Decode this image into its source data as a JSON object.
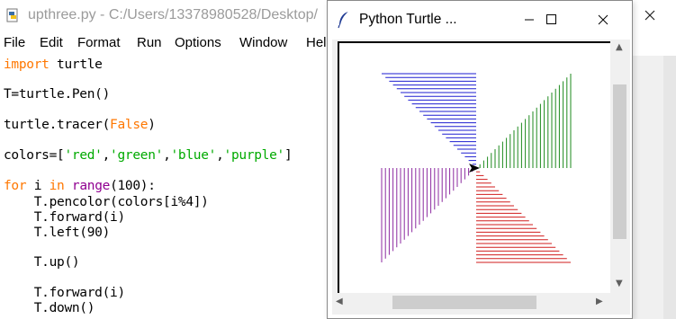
{
  "idle": {
    "title": "upthree.py - C:/Users/13378980528/Desktop/",
    "menu": [
      "File",
      "Edit",
      "Format",
      "Run",
      "Options",
      "Window",
      "Hel"
    ],
    "code": {
      "l1_kw": "import",
      "l1_rest": " turtle",
      "l2": "T=turtle.Pen()",
      "l3_pre": "turtle.tracer(",
      "l3_kw": "False",
      "l3_post": ")",
      "l4_pre": "colors=[",
      "l4_s1": "'red'",
      "l4_c1": ",",
      "l4_s2": "'green'",
      "l4_c2": ",",
      "l4_s3": "'blue'",
      "l4_c3": ",",
      "l4_s4": "'purple'",
      "l4_post": "]",
      "l5_kw1": "for",
      "l5_mid": " i ",
      "l5_kw2": "in",
      "l5_sp": " ",
      "l5_bi": "range",
      "l5_post": "(100):",
      "l6": "    T.pencolor(colors[i%4])",
      "l7": "    T.forward(i)",
      "l8": "    T.left(90)",
      "l9": "    T.up()",
      "l10": "    T.forward(i)",
      "l11": "    T.down()"
    },
    "colors": {
      "keyword": "#ff7700",
      "string": "#00aa00",
      "builtin": "#900090"
    }
  },
  "turtle_window": {
    "title": "Python Turtle ...",
    "controls": [
      "minimize-icon",
      "maximize-icon",
      "close-icon"
    ],
    "line_colors": [
      "red",
      "green",
      "blue",
      "purple"
    ]
  }
}
